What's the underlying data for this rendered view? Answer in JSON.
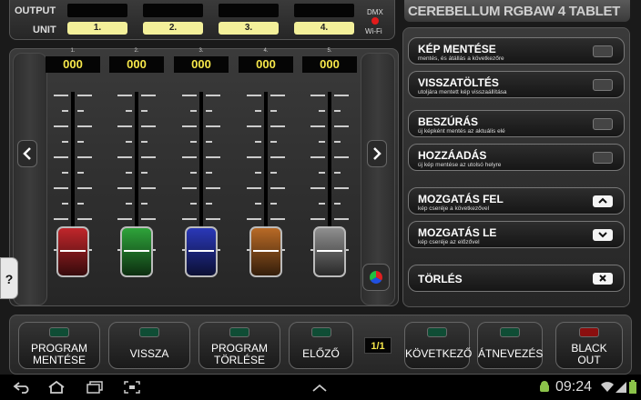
{
  "top": {
    "output_label": "OUTPUT",
    "unit_label": "UNIT",
    "units": [
      "1.",
      "2.",
      "3.",
      "4."
    ],
    "dmx_label": "DMX",
    "wifi_label": "Wi-Fi"
  },
  "app_title": "CEREBELLUM RGBAW 4 TABLET",
  "channels": [
    {
      "num": "1.",
      "value": "000",
      "color": "#c0262b"
    },
    {
      "num": "2.",
      "value": "000",
      "color": "#2ea33a"
    },
    {
      "num": "3.",
      "value": "000",
      "color": "#2a38b8"
    },
    {
      "num": "4.",
      "value": "000",
      "color": "#b86a26"
    },
    {
      "num": "5.",
      "value": "000",
      "color": "#8f8f8f"
    }
  ],
  "help_label": "?",
  "actions": {
    "save_image": {
      "title": "KÉP MENTÉSE",
      "subtitle": "mentés, és átállás a következőre"
    },
    "restore": {
      "title": "VISSZATÖLTÉS",
      "subtitle": "utoljára mentett kép visszaállítása"
    },
    "insert": {
      "title": "BESZÚRÁS",
      "subtitle": "új képként mentés az aktuális elé"
    },
    "add": {
      "title": "HOZZÁADÁS",
      "subtitle": "új kép mentése az utolsó helyre"
    },
    "move_up": {
      "title": "MOZGATÁS FEL",
      "subtitle": "kép cseréje a következővel"
    },
    "move_down": {
      "title": "MOZGATÁS LE",
      "subtitle": "kép cseréje az előzővel"
    },
    "delete": {
      "title": "TÖRLÉS"
    }
  },
  "bottom": {
    "save_program": [
      "PROGRAM",
      "MENTÉSE"
    ],
    "back": "VISSZA",
    "delete_program": [
      "PROGRAM",
      "TÖRLÉSE"
    ],
    "prev": "ELŐZŐ",
    "page": "1/1",
    "next": "KÖVETKEZŐ",
    "rename": "ÁTNEVEZÉS",
    "blackout": [
      "BLACK",
      "OUT"
    ]
  },
  "status": {
    "time": "09:24"
  },
  "colors": {
    "led_off": "#0f4d35",
    "blackout_led": "#8a0f0f",
    "value_text": "#f6e74a"
  }
}
